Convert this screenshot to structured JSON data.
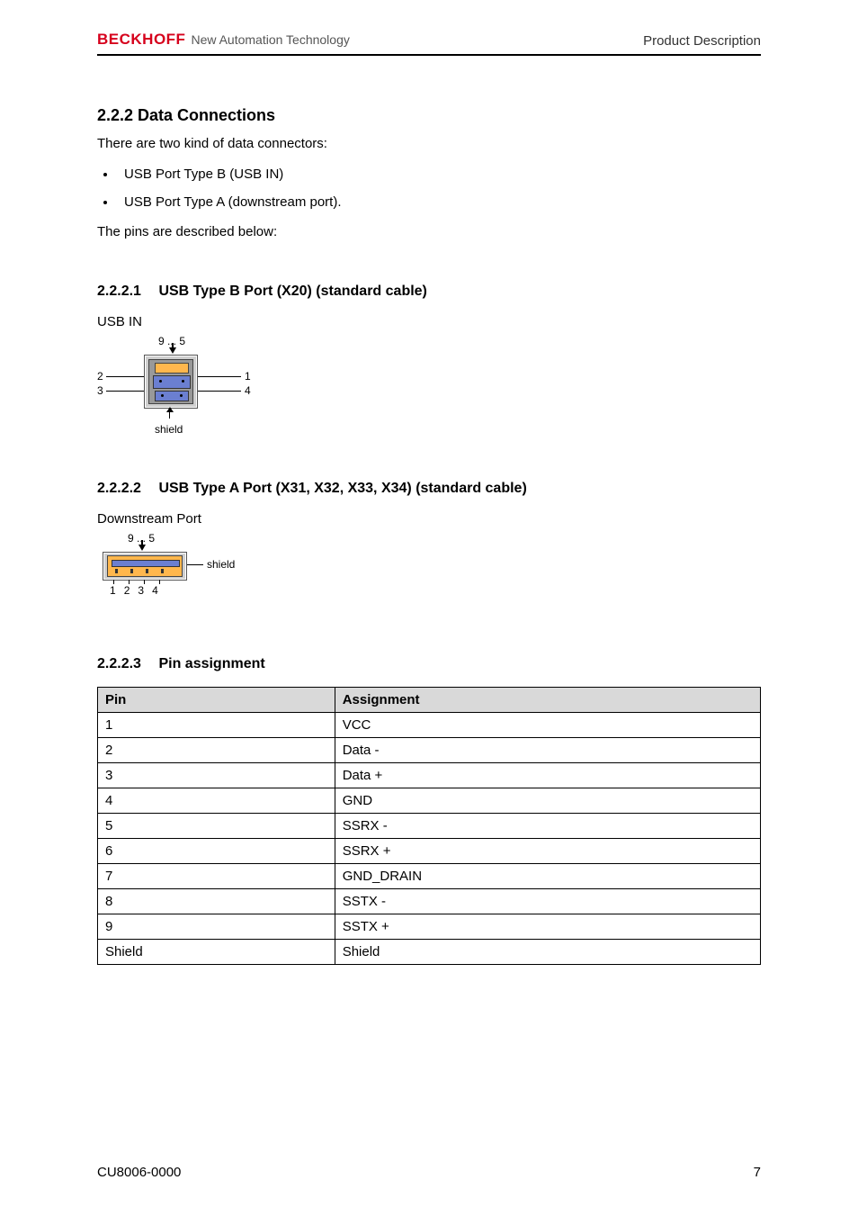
{
  "header": {
    "brand_name": "BECKHOFF",
    "brand_tagline": "New Automation Technology",
    "right": "Product Description"
  },
  "section": {
    "num_title": "2.2.2  Data Connections",
    "intro": "There are two kind of data connectors:",
    "bullets": [
      "USB Port Type B (USB IN)",
      "USB Port Type A (downstream port)."
    ],
    "outro": "The pins are described below:"
  },
  "sub1": {
    "num": "2.2.2.1",
    "title": "USB Type B Port (X20) (standard cable)",
    "label": "USB  IN",
    "diagram": {
      "top_range": "9 ... 5",
      "left_top": "2",
      "left_bot": "3",
      "right_top": "1",
      "right_bot": "4",
      "shield": "shield"
    }
  },
  "sub2": {
    "num": "2.2.2.2",
    "title": "USB Type A Port (X31, X32, X33, X34) (standard cable)",
    "label": "Downstream Port",
    "diagram": {
      "top_range": "9 ... 5",
      "shield": "shield",
      "pins": [
        "1",
        "2",
        "3",
        "4"
      ]
    }
  },
  "sub3": {
    "num": "2.2.2.3",
    "title": "Pin assignment",
    "table": {
      "headers": [
        "Pin",
        "Assignment"
      ],
      "rows": [
        [
          "1",
          "VCC"
        ],
        [
          "2",
          "Data -"
        ],
        [
          "3",
          "Data +"
        ],
        [
          "4",
          "GND"
        ],
        [
          "5",
          "SSRX -"
        ],
        [
          "6",
          "SSRX +"
        ],
        [
          "7",
          "GND_DRAIN"
        ],
        [
          "8",
          "SSTX -"
        ],
        [
          "9",
          "SSTX +"
        ],
        [
          "Shield",
          "Shield"
        ]
      ]
    }
  },
  "footer": {
    "left": "CU8006-0000",
    "right": "7"
  }
}
